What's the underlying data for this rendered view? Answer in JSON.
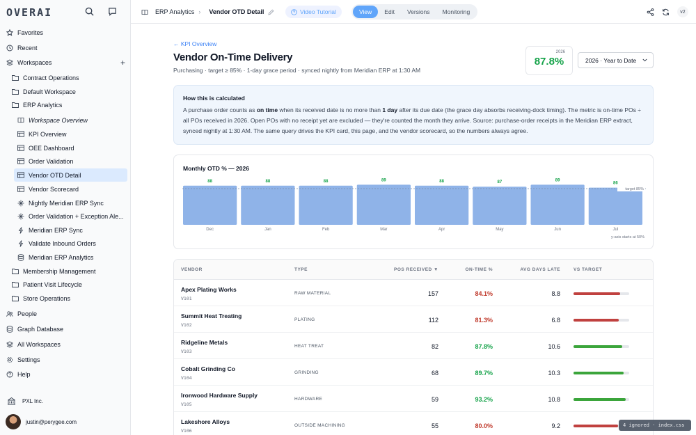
{
  "app": {
    "logo": "OVERAI"
  },
  "sidebar": {
    "top_items": [
      {
        "label": "Favorites",
        "icon": "star-icon"
      },
      {
        "label": "Recent",
        "icon": "clock-icon"
      },
      {
        "label": "Workspaces",
        "icon": "layers-icon"
      }
    ],
    "workspaces": [
      {
        "label": "Contract Operations"
      },
      {
        "label": "Default Workspace"
      },
      {
        "label": "ERP Analytics"
      }
    ],
    "erp_children": [
      {
        "label": "Workspace Overview",
        "icon": "book-icon"
      },
      {
        "label": "KPI Overview",
        "icon": "table-icon"
      },
      {
        "label": "OEE Dashboard",
        "icon": "table-icon"
      },
      {
        "label": "Order Validation",
        "icon": "table-icon"
      },
      {
        "label": "Vendor OTD Detail",
        "icon": "table-icon"
      },
      {
        "label": "Vendor Scorecard",
        "icon": "table-icon"
      },
      {
        "label": "Nightly Meridian ERP Sync",
        "icon": "workflow-icon"
      },
      {
        "label": "Order Validation + Exception Ale...",
        "icon": "workflow-icon"
      },
      {
        "label": "Meridian ERP Sync",
        "icon": "bolt-icon"
      },
      {
        "label": "Validate Inbound Orders",
        "icon": "bolt-icon"
      },
      {
        "label": "Meridian ERP Analytics",
        "icon": "database-icon"
      }
    ],
    "more_workspaces": [
      {
        "label": "Membership Management"
      },
      {
        "label": "Patient Visit Lifecycle"
      },
      {
        "label": "Store Operations"
      }
    ],
    "bottom_items": [
      {
        "label": "People",
        "icon": "people-icon"
      },
      {
        "label": "Graph Database",
        "icon": "database-icon"
      },
      {
        "label": "All Workspaces",
        "icon": "layers-icon"
      },
      {
        "label": "Settings",
        "icon": "gear-icon"
      },
      {
        "label": "Help",
        "icon": "help-icon"
      }
    ],
    "org": "PXL Inc.",
    "user_email": "justin@perygee.com"
  },
  "topbar": {
    "breadcrumb_parent": "ERP Analytics",
    "breadcrumb_current": "Vendor OTD Detail",
    "video_tutorial": "Video Tutorial",
    "modes": [
      "View",
      "Edit",
      "Versions",
      "Monitoring"
    ],
    "active_mode": "View",
    "version": "v2"
  },
  "page": {
    "back_link": "← KPI Overview",
    "title": "Vendor On-Time Delivery",
    "subtitle": "Purchasing · target ≥ 85% · 1-day grace period · synced nightly from Meridian ERP at 1:30 AM",
    "kpi_year": "2026",
    "kpi_value": "87.8%",
    "period_select": "2026 · Year to Date"
  },
  "info": {
    "heading": "How this is calculated",
    "text_1": "A purchase order counts as ",
    "bold_1": "on time",
    "text_2": " when its received date is no more than ",
    "bold_2": "1 day",
    "text_3": " after its due date (the grace day absorbs receiving-dock timing). The metric is on-time POs ÷ all POs received in 2026. Open POs with no receipt yet are excluded — they're counted the month they arrive. Source: purchase-order receipts in the Meridian ERP extract, synced nightly at 1:30 AM. The same query drives the KPI card, this page, and the vendor scorecard, so the numbers always agree."
  },
  "chart_data": {
    "type": "bar",
    "title": "Monthly OTD % — 2026",
    "categories": [
      "Dec",
      "Jan",
      "Feb",
      "Mar",
      "Apr",
      "May",
      "Jun",
      "Jul"
    ],
    "series": [
      {
        "values": [
          88,
          88,
          88,
          89,
          88,
          87,
          89,
          86
        ]
      }
    ],
    "ylim": [
      50,
      100
    ],
    "target": 85,
    "target_label": "target 85%",
    "footnote": "y-axis starts at 50%",
    "bar_color": "#8fb3e8"
  },
  "table": {
    "headers": {
      "vendor": "VENDOR",
      "type": "TYPE",
      "pos": "POS RECEIVED ▼",
      "ontime": "ON-TIME %",
      "days": "AVG DAYS LATE",
      "target": "VS TARGET"
    },
    "rows": [
      {
        "vendor": "Apex Plating Works",
        "code": "V101",
        "type": "RAW MATERIAL",
        "pos": "157",
        "ontime": "84.1%",
        "ontime_value": 84.1,
        "days": "8.8",
        "status": "below"
      },
      {
        "vendor": "Summit Heat Treating",
        "code": "V102",
        "type": "PLATING",
        "pos": "112",
        "ontime": "81.3%",
        "ontime_value": 81.3,
        "days": "6.8",
        "status": "below"
      },
      {
        "vendor": "Ridgeline Metals",
        "code": "V103",
        "type": "HEAT TREAT",
        "pos": "82",
        "ontime": "87.8%",
        "ontime_value": 87.8,
        "days": "10.6",
        "status": "above"
      },
      {
        "vendor": "Cobalt Grinding Co",
        "code": "V104",
        "type": "GRINDING",
        "pos": "68",
        "ontime": "89.7%",
        "ontime_value": 89.7,
        "days": "10.3",
        "status": "above"
      },
      {
        "vendor": "Ironwood Hardware Supply",
        "code": "V105",
        "type": "HARDWARE",
        "pos": "59",
        "ontime": "93.2%",
        "ontime_value": 93.2,
        "days": "10.8",
        "status": "above"
      },
      {
        "vendor": "Lakeshore Alloys",
        "code": "V106",
        "type": "OUTSIDE MACHINING",
        "pos": "55",
        "ontime": "80.0%",
        "ontime_value": 80.0,
        "days": "9.2",
        "status": "below"
      }
    ]
  },
  "colors": {
    "good": "#16a34a",
    "bad": "#c0392b",
    "bar_good": "#3ba53b",
    "bar_bad": "#c0413f",
    "accent": "#60a5fa"
  },
  "toast": "4 ignored · index.css"
}
